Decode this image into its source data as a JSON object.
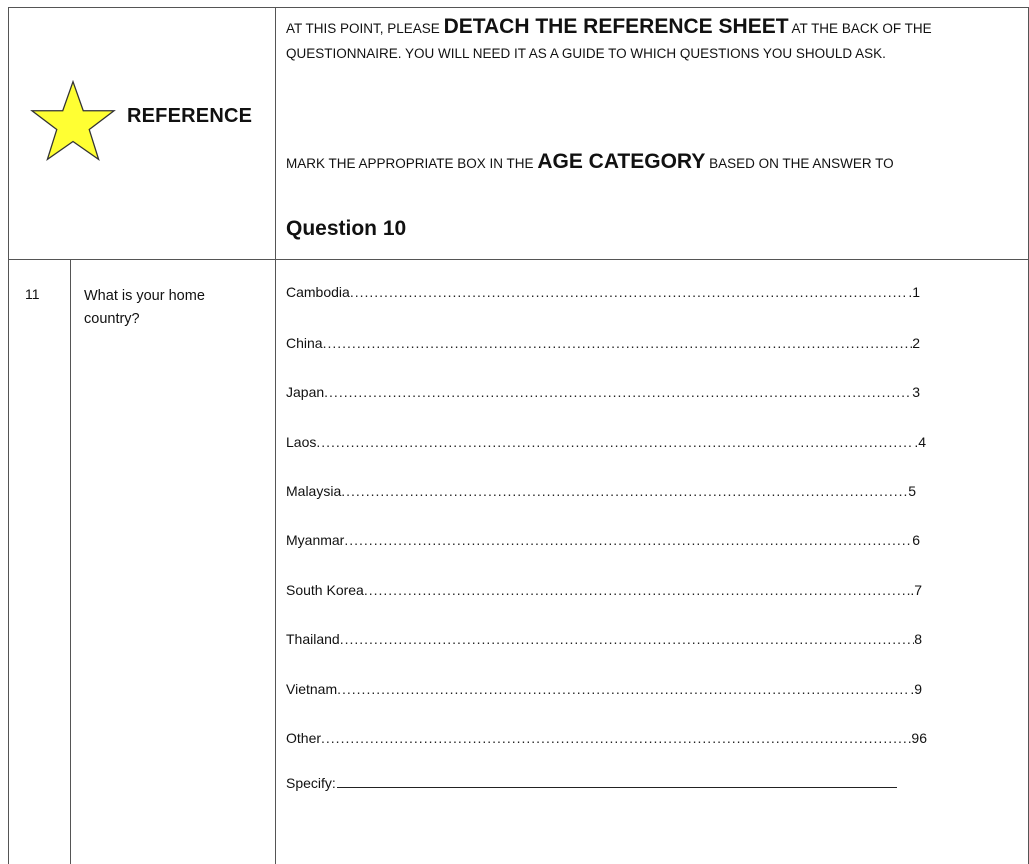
{
  "header": {
    "reference_label": "REFERENCE",
    "instruction1_pre": "AT THIS POINT, PLEASE ",
    "instruction1_big": "DETACH THE REFERENCE SHEET",
    "instruction1_post": " AT THE BACK OF THE QUESTIONNAIRE. YOU WILL NEED IT AS A GUIDE TO WHICH QUESTIONS YOU SHOULD ASK.",
    "instruction2_pre": "MARK THE APPROPRIATE BOX IN THE ",
    "instruction2_big": "AGE CATEGORY",
    "instruction2_post": " BASED ON THE ANSWER TO",
    "question_ref": "Question 10",
    "star_color": "#FFFF33"
  },
  "question": {
    "number": "11",
    "text": "What is your home country?",
    "options": [
      {
        "label": "Cambodia",
        "code": ".1"
      },
      {
        "label": "China",
        "code": "2"
      },
      {
        "label": "Japan",
        "code": "3"
      },
      {
        "label": "Laos",
        "code": ".4"
      },
      {
        "label": "Malaysia",
        "code": "5"
      },
      {
        "label": "Myanmar",
        "code": "6"
      },
      {
        "label": "South Korea",
        "code": ".7"
      },
      {
        "label": "Thailand",
        "code": "8"
      },
      {
        "label": "Vietnam",
        "code": ".9"
      },
      {
        "label": "Other",
        "code": "96"
      }
    ],
    "specify_label": "Specify:"
  }
}
